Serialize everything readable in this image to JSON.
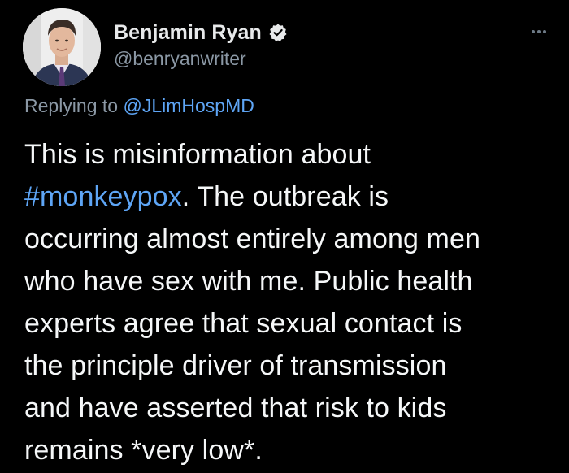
{
  "author": {
    "display_name": "Benjamin Ryan",
    "handle": "@benryanwriter"
  },
  "reply": {
    "prefix": "Replying to ",
    "mention": "@JLimHospMD"
  },
  "tweet": {
    "line1": "This is misinformation about",
    "hashtag": "#monkeypox",
    "line2_rest": ". The outbreak is",
    "line3": "occurring almost entirely among men",
    "line4": "who have sex with me. Public health",
    "line5": "experts agree that sexual contact is",
    "line6": "the principle driver of transmission",
    "line7": "and have asserted that risk to kids",
    "line8": "remains *very low*."
  },
  "icons": {
    "verified": "verified-badge-icon",
    "more": "more-options-icon"
  },
  "colors": {
    "background": "#000000",
    "text": "#e7e9ea",
    "secondary": "#8b98a5",
    "link": "#5ea5f5"
  }
}
